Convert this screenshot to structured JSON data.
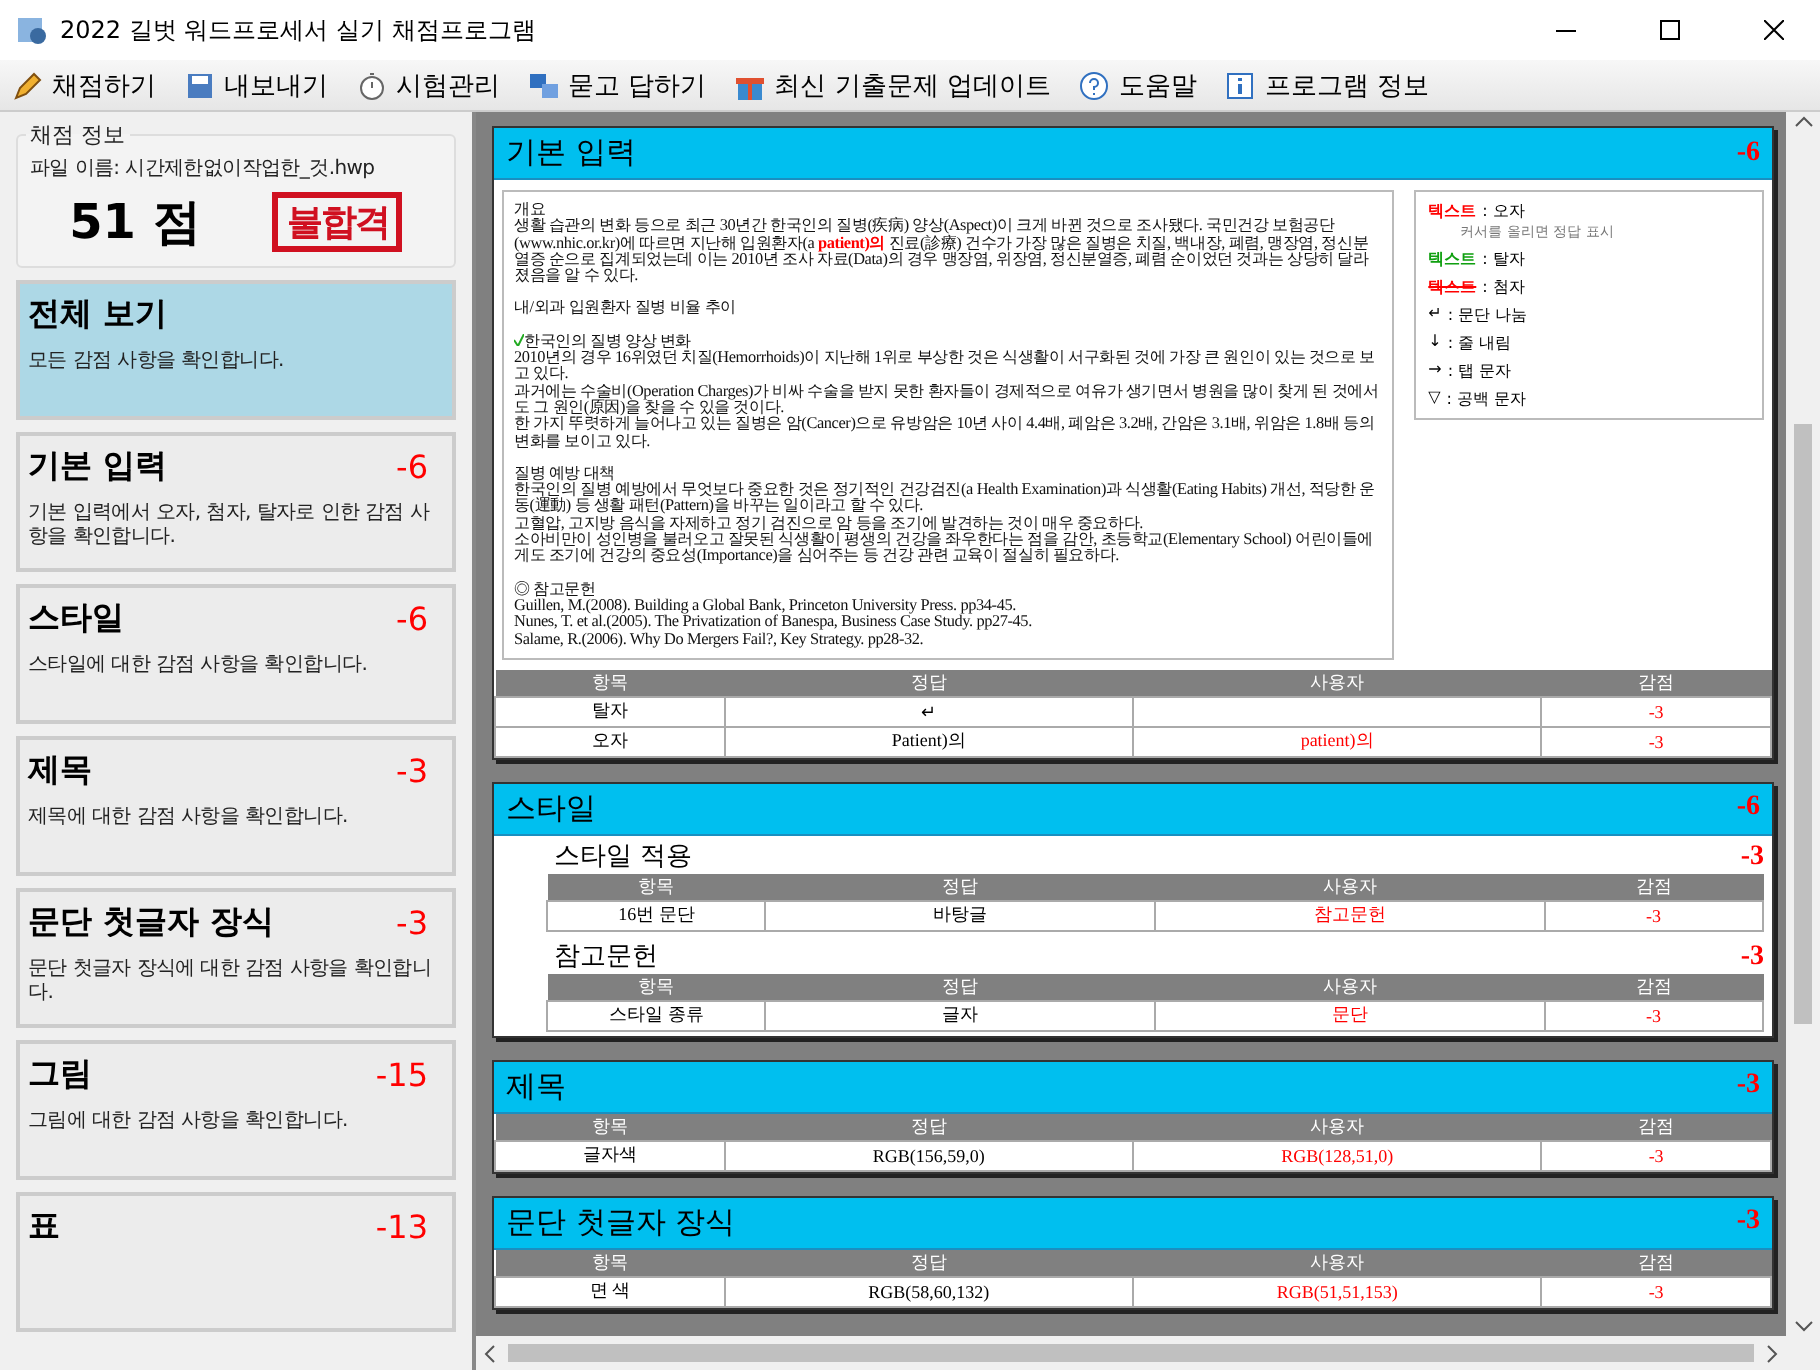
{
  "window": {
    "title": "2022 길벗 워드프로세서 실기 채점프로그램"
  },
  "toolbar": [
    {
      "label": "채점하기"
    },
    {
      "label": "내보내기"
    },
    {
      "label": "시험관리"
    },
    {
      "label": "묻고 답하기"
    },
    {
      "label": "최신 기출문제 업데이트"
    },
    {
      "label": "도움말"
    },
    {
      "label": "프로그램 정보"
    }
  ],
  "score_panel": {
    "legend": "채점 정보",
    "file_name": "파일 이름: 시간제한없이작업한_것.hwp",
    "score": "51 점",
    "result": "불합격"
  },
  "categories": [
    {
      "title": "전체 보기",
      "description": "모든 감점 사항을 확인합니다.",
      "selected": true
    },
    {
      "title": "기본 입력",
      "deduction": "-6",
      "description": "기본 입력에서 오자, 첨자, 탈자로 인한 감점 사항을 확인합니다.",
      "selected": false
    },
    {
      "title": "스타일",
      "deduction": "-6",
      "description": "스타일에 대한 감점 사항을 확인합니다.",
      "selected": false
    },
    {
      "title": "제목",
      "deduction": "-3",
      "description": "제목에 대한 감점 사항을 확인합니다.",
      "selected": false
    },
    {
      "title": "문단 첫글자 장식",
      "deduction": "-3",
      "description": "문단 첫글자 장식에 대한 감점 사항을 확인합니다.",
      "selected": false
    },
    {
      "title": "그림",
      "deduction": "-15",
      "description": "그림에 대한 감점 사항을 확인합니다.",
      "selected": false
    },
    {
      "title": "표",
      "deduction": "-13",
      "selected": false
    }
  ],
  "sections": [
    {
      "title": "기본 입력",
      "deduction": "-6",
      "preview": {
        "paragraphs": [
          [
            {
              "text": "개요"
            }
          ],
          [
            {
              "text": "생활 습관의 변화 등으로 최근 30년간 한국인의 질병(疾病) 양상(Aspect)이 크게 바뀐 것으로 조사됐다. 국민건강 보험공단(www.nhic.or.kr)에 따르면 지난해 입원환자(a "
            },
            {
              "text": "patient)의",
              "error": true
            },
            {
              "text": " 진료(診療) 건수가 가장 많은 질병은 치질, 백내장, 폐렴, 맹장염, 정신분열증 순으로 집계되었는데 이는 2010년 조사 자료(Data)의 경우 맹장염, 위장염, 정신분열증, 폐렴 순이었던 것과는 상당히 달라졌음을 알 수 있다."
            }
          ],
          [
            {
              "text": "내/외과 입원환자 질병 비율 추이",
              "gap": true
            }
          ],
          [
            {
              "text": "한국인의 질병 양상 변화",
              "gap": true,
              "checked": true
            }
          ],
          [
            {
              "text": "2010년의 경우 16위였던 치질(Hemorrhoids)이 지난해 1위로 부상한 것은 식생활이 서구화된 것에 가장 큰 원인이 있는 것으로 보고 있다."
            }
          ],
          [
            {
              "text": "과거에는 수술비(Operation Charges)가 비싸 수술을 받지 못한 환자들이 경제적으로 여유가 생기면서 병원을 많이 찾게 된 것에서도 그 원인(原因)을 찾을 수 있을 것이다."
            }
          ],
          [
            {
              "text": "한 가지 뚜렷하게 늘어나고 있는 질병은 암(Cancer)으로 유방암은 10년 사이 4.4배, 폐암은 3.2배, 간암은 3.1배, 위암은 1.8배 등의 변화를 보이고 있다."
            }
          ],
          [
            {
              "text": "질병 예방 대책",
              "gap": true
            }
          ],
          [
            {
              "text": "한국인의 질병 예방에서 무엇보다 중요한 것은 정기적인 건강검진(a Health Examination)과 식생활(Eating Habits) 개선, 적당한 운동(運動) 등 생활 패턴(Pattern)을 바꾸는 일이라고 할 수 있다."
            }
          ],
          [
            {
              "text": "고혈압, 고지방 음식을 자제하고 정기 검진으로 암 등을 조기에 발견하는 것이 매우 중요하다."
            }
          ],
          [
            {
              "text": "소아비만이 성인병을 불러오고 잘못된 식생활이 평생의 건강을 좌우한다는 점을 감안, 초등학교(Elementary School) 어린이들에게도 조기에 건강의 중요성(Importance)을 심어주는 등 건강 관련 교육이 절실히 필요하다."
            }
          ],
          [
            {
              "text": "◎ 참고문헌",
              "gap": true
            }
          ],
          [
            {
              "text": "Guillen, M.(2008). Building a Global Bank, Princeton University Press. pp34-45."
            }
          ],
          [
            {
              "text": "Nunes, T. et al.(2005). The Privatization of Banespa, Business Case Study. pp27-45."
            }
          ],
          [
            {
              "text": "Salame, R.(2006). Why Do Mergers Fail?, Key Strategy. pp28-32."
            }
          ]
        ],
        "legend": [
          {
            "kind": "typo",
            "sample": "텍스트",
            "label": ": 오자",
            "note": "커서를 올리면 정답 표시"
          },
          {
            "kind": "missing",
            "sample": "텍스트",
            "label": ": 탈자"
          },
          {
            "kind": "extra",
            "sample": "텍스트",
            "label": ": 첨자"
          },
          {
            "kind": "symbol",
            "sample": "↵",
            "label": ": 문단 나눔"
          },
          {
            "kind": "symbol",
            "sample": "↓",
            "label": ": 줄 내림"
          },
          {
            "kind": "symbol",
            "sample": "→",
            "label": ": 탭 문자"
          },
          {
            "kind": "symbol",
            "sample": "▽",
            "label": ": 공백 문자"
          }
        ]
      },
      "tables": [
        {
          "columns": [
            "항목",
            "정답",
            "사용자",
            "감점"
          ],
          "rows": [
            [
              "탈자",
              "↵",
              "",
              "-3"
            ],
            [
              "오자",
              "Patient)의",
              "patient)의",
              "-3"
            ]
          ]
        }
      ]
    },
    {
      "title": "스타일",
      "deduction": "-6",
      "tables": [
        {
          "heading": "스타일 적용",
          "deduction": "-3",
          "columns": [
            "항목",
            "정답",
            "사용자",
            "감점"
          ],
          "rows": [
            [
              "16번 문단",
              "바탕글",
              "참고문헌",
              "-3"
            ]
          ]
        },
        {
          "heading": "참고문헌",
          "deduction": "-3",
          "columns": [
            "항목",
            "정답",
            "사용자",
            "감점"
          ],
          "rows": [
            [
              "스타일 종류",
              "글자",
              "문단",
              "-3"
            ]
          ]
        }
      ]
    },
    {
      "title": "제목",
      "deduction": "-3",
      "tables": [
        {
          "columns": [
            "항목",
            "정답",
            "사용자",
            "감점"
          ],
          "rows": [
            [
              "글자색",
              "RGB(156,59,0)",
              "RGB(128,51,0)",
              "-3"
            ]
          ]
        }
      ]
    },
    {
      "title": "문단 첫글자 장식",
      "deduction": "-3",
      "tables": [
        {
          "columns": [
            "항목",
            "정답",
            "사용자",
            "감점"
          ],
          "rows": [
            [
              "면 색",
              "RGB(58,60,132)",
              "RGB(51,51,153)",
              "-3"
            ]
          ]
        }
      ]
    }
  ]
}
